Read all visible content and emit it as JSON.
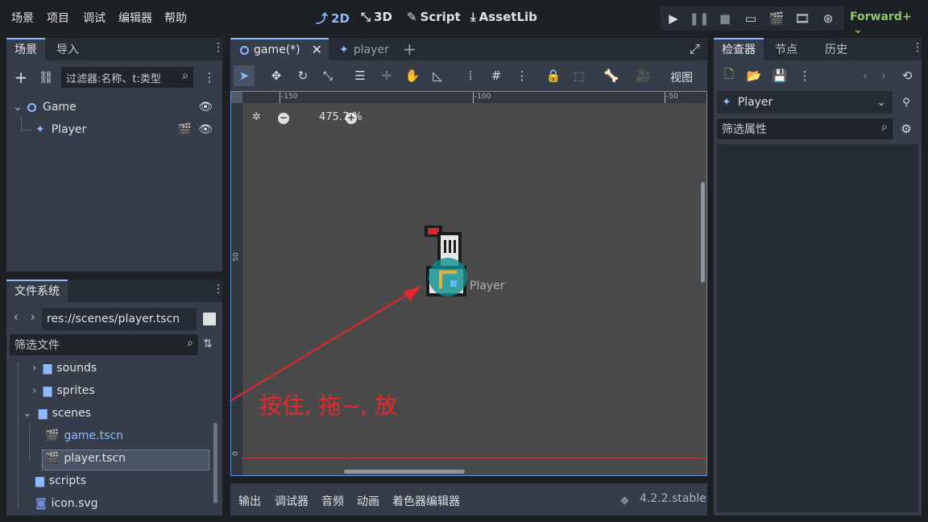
{
  "menu": [
    "场景",
    "项目",
    "调试",
    "编辑器",
    "帮助"
  ],
  "workspaces": [
    {
      "label": "2D",
      "icon": "2d-icon",
      "active": true
    },
    {
      "label": "3D",
      "icon": "3d-icon",
      "active": false
    },
    {
      "label": "Script",
      "icon": "script-icon",
      "active": false
    },
    {
      "label": "AssetLib",
      "icon": "assetlib-icon",
      "active": false
    }
  ],
  "renderer": "Forward+",
  "scene_dock": {
    "tabs": [
      "场景",
      "导入"
    ],
    "filter_placeholder": "过滤器:名称、t:类型",
    "tree": [
      {
        "label": "Game",
        "icon": "node2d-icon"
      },
      {
        "label": "Player",
        "icon": "character-icon"
      }
    ]
  },
  "filesystem_dock": {
    "title": "文件系统",
    "path": "res://scenes/player.tscn",
    "filter_placeholder": "筛选文件",
    "items": [
      {
        "label": "sounds",
        "type": "folder"
      },
      {
        "label": "sprites",
        "type": "folder"
      },
      {
        "label": "scenes",
        "type": "folder"
      },
      {
        "label": "game.tscn",
        "type": "scene"
      },
      {
        "label": "player.tscn",
        "type": "scene"
      },
      {
        "label": "scripts",
        "type": "folder"
      },
      {
        "label": "icon.svg",
        "type": "image"
      }
    ]
  },
  "editor_tabs": [
    {
      "label": "game(*)",
      "active": true
    },
    {
      "label": "player",
      "active": false
    }
  ],
  "toolbar": {
    "view_label": "视图"
  },
  "viewport": {
    "zoom": "475.7 %",
    "node_label": "Player",
    "annotation": "按住, 拖~, 放",
    "ruler_top": [
      "-150",
      "-100",
      "-50"
    ],
    "ruler_left": [
      "50",
      "0"
    ]
  },
  "bottom_panel": {
    "tabs": [
      "输出",
      "调试器",
      "音频",
      "动画",
      "着色器编辑器"
    ],
    "version": "4.2.2.stable"
  },
  "inspector": {
    "tabs": [
      "检查器",
      "节点",
      "历史"
    ],
    "node_name": "Player",
    "filter_placeholder": "筛选属性"
  },
  "colors": {
    "accent": "#8fb8ff",
    "renderer": "#8fc56a",
    "annotation": "#e8262b",
    "panel": "#363d4a",
    "background": "#1d2126"
  }
}
